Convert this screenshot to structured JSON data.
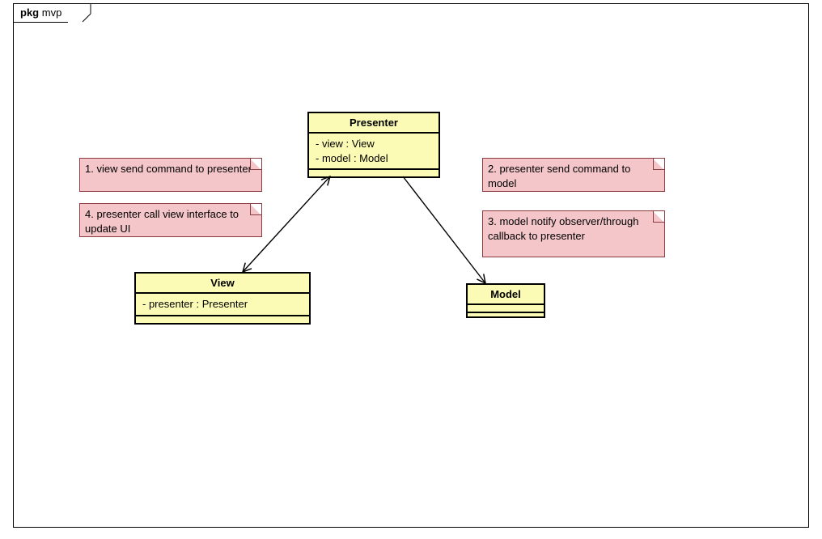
{
  "package": {
    "keyword": "pkg",
    "name": "mvp"
  },
  "classes": {
    "presenter": {
      "title": "Presenter",
      "attrs": [
        "- view : View",
        "- model : Model"
      ]
    },
    "view": {
      "title": "View",
      "attrs": [
        "- presenter : Presenter"
      ]
    },
    "model": {
      "title": "Model",
      "attrs": []
    }
  },
  "notes": {
    "n1": "1. view send command to presenter",
    "n4": "4. presenter call view interface to update UI",
    "n2": "2. presenter send command to model",
    "n3": "3. model notify observer/through callback to presenter"
  }
}
